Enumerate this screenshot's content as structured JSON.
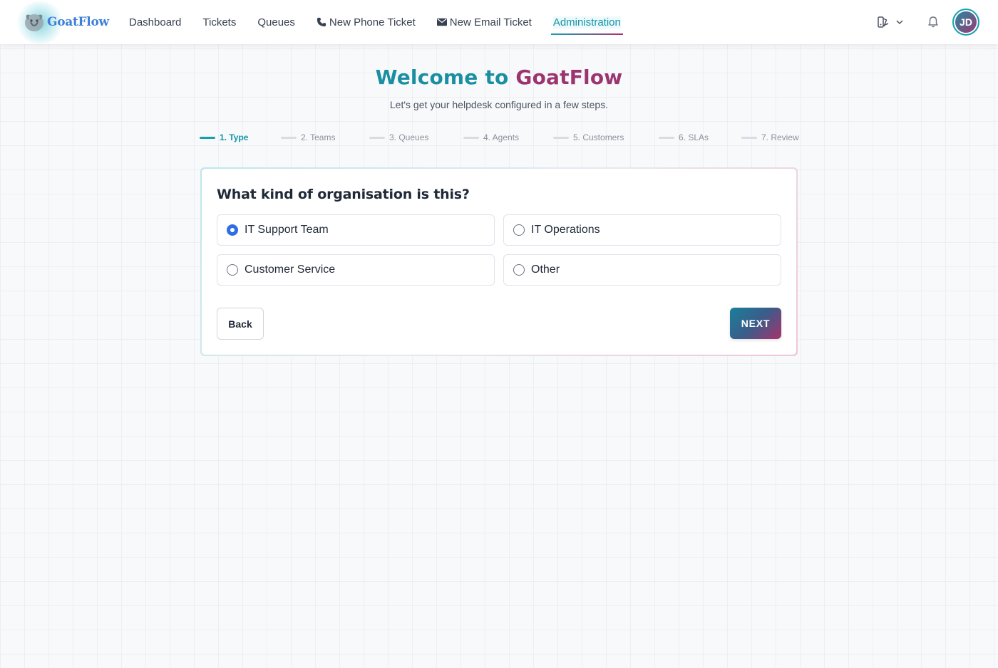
{
  "app": {
    "brand": "GoatFlow",
    "colors": {
      "teal": "#1b8fa2",
      "magenta": "#9b3570",
      "radio_blue": "#2f6ee2"
    }
  },
  "nav": {
    "items": [
      {
        "label": "Dashboard",
        "icon": ""
      },
      {
        "label": "Tickets",
        "icon": ""
      },
      {
        "label": "Queues",
        "icon": ""
      },
      {
        "label": "New Phone Ticket",
        "icon": "phone-icon"
      },
      {
        "label": "New Email Ticket",
        "icon": "envelope-icon"
      },
      {
        "label": "Administration",
        "icon": "",
        "active": true
      }
    ]
  },
  "user": {
    "initials": "JD"
  },
  "header": {
    "title_part1": "Welcome to",
    "title_part2": "GoatFlow",
    "subtitle": "Let's get your helpdesk configured in a few steps."
  },
  "steps": [
    {
      "label": "1. Type",
      "active": true
    },
    {
      "label": "2. Teams",
      "active": false
    },
    {
      "label": "3. Queues",
      "active": false
    },
    {
      "label": "4. Agents",
      "active": false
    },
    {
      "label": "5. Customers",
      "active": false
    },
    {
      "label": "6. SLAs",
      "active": false
    },
    {
      "label": "7. Review",
      "active": false
    }
  ],
  "form": {
    "question": "What kind of organisation is this?",
    "options": [
      {
        "label": "IT Support Team",
        "checked": true
      },
      {
        "label": "IT Operations",
        "checked": false
      },
      {
        "label": "Customer Service",
        "checked": false
      },
      {
        "label": "Other",
        "checked": false
      }
    ],
    "back_label": "Back",
    "next_label": "NEXT"
  }
}
